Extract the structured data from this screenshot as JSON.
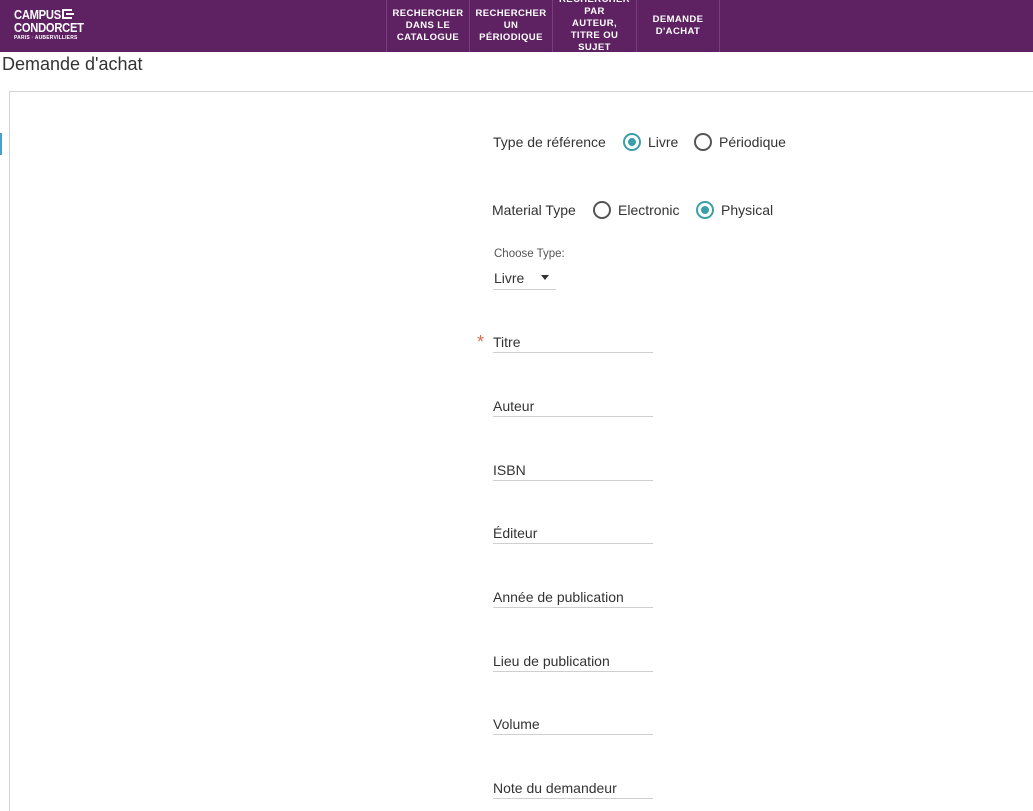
{
  "logo": {
    "line1": "CAMPUS",
    "line2": "CONDORCET",
    "line3": "PARIS · AUBERVILLIERS"
  },
  "nav": {
    "items": [
      {
        "label": "RECHERCHER\nDANS LE\nCATALOGUE"
      },
      {
        "label": "RECHERCHER\nUN\nPÉRIODIQUE"
      },
      {
        "label": "RECHERCHER\nPAR\nAUTEUR,\nTITRE OU\nSUJET"
      },
      {
        "label": "DEMANDE\nD'ACHAT"
      }
    ]
  },
  "page": {
    "title": "Demande d'achat"
  },
  "form": {
    "reference_type": {
      "label": "Type de référence",
      "options": [
        {
          "label": "Livre",
          "checked": true
        },
        {
          "label": "Périodique",
          "checked": false
        }
      ]
    },
    "material_type": {
      "label": "Material Type",
      "options": [
        {
          "label": "Electronic",
          "checked": false
        },
        {
          "label": "Physical",
          "checked": true
        }
      ]
    },
    "choose_type": {
      "label": "Choose Type:",
      "value": "Livre"
    },
    "required_marker": "*",
    "fields": {
      "titre": {
        "placeholder": "Titre",
        "value": ""
      },
      "auteur": {
        "placeholder": "Auteur",
        "value": ""
      },
      "isbn": {
        "placeholder": "ISBN",
        "value": ""
      },
      "editeur": {
        "placeholder": "Éditeur",
        "value": ""
      },
      "annee": {
        "placeholder": "Année de publication",
        "value": ""
      },
      "lieu": {
        "placeholder": "Lieu de publication",
        "value": ""
      },
      "volume": {
        "placeholder": "Volume",
        "value": ""
      },
      "note": {
        "placeholder": "Note du demandeur",
        "value": ""
      }
    }
  },
  "colors": {
    "header_bg": "#5e2263",
    "accent": "#3aa0a8",
    "required": "#e06a4e"
  }
}
